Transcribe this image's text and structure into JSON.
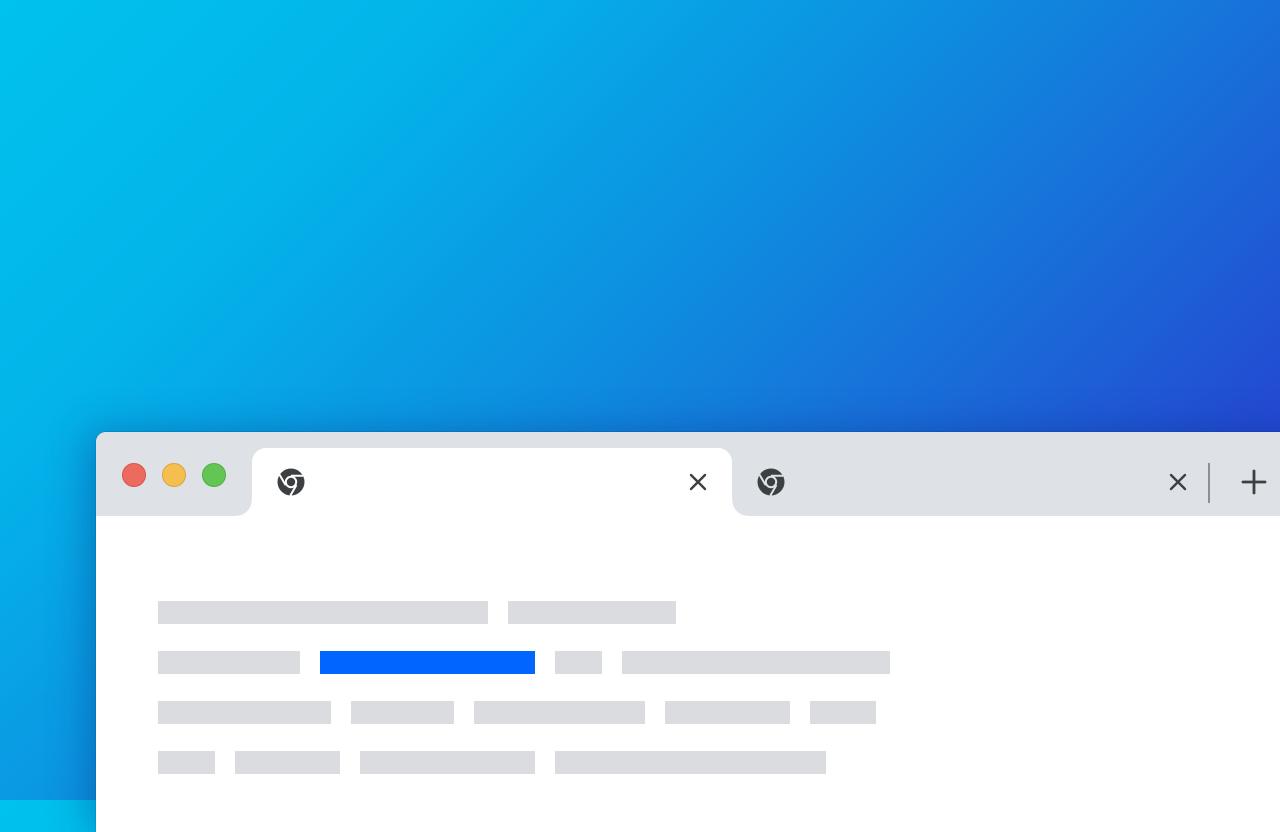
{
  "desktop": {
    "gradient_start": "#00c2ee",
    "gradient_end": "#2b2bc9"
  },
  "window": {
    "traffic_lights": {
      "close": "#ed6a5e",
      "minimize": "#f5bf4f",
      "zoom": "#62c554"
    },
    "tabs": [
      {
        "active": true,
        "favicon": "chrome-icon",
        "close_icon": "close-icon"
      },
      {
        "active": false,
        "favicon": "chrome-icon",
        "close_icon": "close-icon"
      }
    ],
    "new_tab_icon": "plus-icon",
    "tabbar_color": "#dee1e6"
  },
  "content": {
    "placeholder_color": "#dadce0",
    "accent_color": "#0066ff",
    "rows": [
      {
        "bars": [
          {
            "style": "gray"
          },
          {
            "style": "gray"
          }
        ]
      },
      {
        "bars": [
          {
            "style": "gray"
          },
          {
            "style": "accent"
          },
          {
            "style": "gray"
          },
          {
            "style": "gray"
          }
        ]
      },
      {
        "bars": [
          {
            "style": "gray"
          },
          {
            "style": "gray"
          },
          {
            "style": "gray"
          },
          {
            "style": "gray"
          },
          {
            "style": "gray"
          }
        ]
      },
      {
        "bars": [
          {
            "style": "gray"
          },
          {
            "style": "gray"
          },
          {
            "style": "gray"
          },
          {
            "style": "gray"
          }
        ]
      }
    ]
  }
}
